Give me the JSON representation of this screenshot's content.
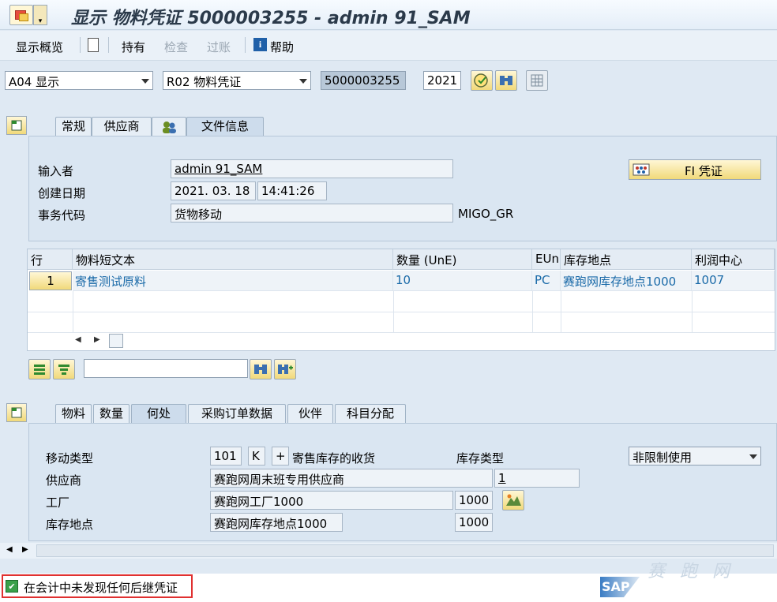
{
  "title": "显示 物料凭证 5000003255 - admin 91_SAM",
  "toolbar": {
    "overview": "显示概览",
    "hold": "持有",
    "check": "检查",
    "post": "过账",
    "help": "帮助"
  },
  "selector": {
    "action": "A04 显示",
    "reference": "R02 物料凭证",
    "doc_number": "5000003255",
    "year": "2021"
  },
  "header_tabs": [
    "常规",
    "供应商",
    "",
    "文件信息"
  ],
  "header": {
    "entered_by_label": "输入者",
    "entered_by": "admin 91_SAM",
    "created_label": "创建日期",
    "created_date": "2021. 03. 18",
    "created_time": "14:41:26",
    "tcode_label": "事务代码",
    "tcode_desc": "货物移动",
    "tcode": "MIGO_GR",
    "fi_button": "FI 凭证"
  },
  "items": {
    "columns": [
      "行",
      "物料短文本",
      "数量 (UnE)",
      "EUn",
      "库存地点",
      "利润中心"
    ],
    "rows": [
      {
        "line": "1",
        "text": "寄售测试原料",
        "qty": "10",
        "unit": "PC",
        "sloc": "赛跑网库存地点1000",
        "profit": "1007"
      }
    ]
  },
  "detail_tabs": [
    "物料",
    "数量",
    "何处",
    "采购订单数据",
    "伙伴",
    "科目分配"
  ],
  "detail": {
    "mvt_label": "移动类型",
    "mvt": "101",
    "mvt_k": "K",
    "mvt_plus": "+",
    "mvt_desc": "寄售库存的收货",
    "stock_type_label": "库存类型",
    "stock_type": "非限制使用",
    "vendor_label": "供应商",
    "vendor": "赛跑网周末班专用供应商",
    "vendor_no": "1",
    "plant_label": "工厂",
    "plant": "赛跑网工厂1000",
    "plant_code": "1000",
    "sloc_label": "库存地点",
    "sloc": "赛跑网库存地点1000",
    "sloc_code": "1000"
  },
  "status": {
    "message": "在会计中未发现任何后继凭证"
  },
  "brand": "SAP",
  "watermark": "赛 跑 网",
  "colors": {
    "link": "#1a6aa8",
    "status_border": "#e03030",
    "check_green": "#3aa04a"
  }
}
